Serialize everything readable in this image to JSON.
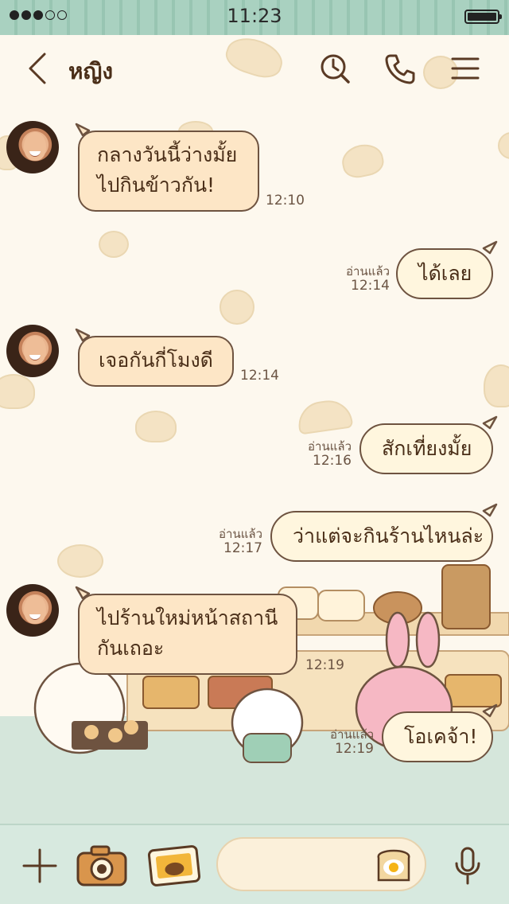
{
  "status_bar": {
    "time": "11:23",
    "signal_filled": 3,
    "signal_total": 5,
    "battery_level": 1.0
  },
  "header": {
    "title": "หญิง",
    "back_icon": "chevron-left-icon",
    "search_icon": "clock-search-icon",
    "call_icon": "phone-icon",
    "menu_icon": "hamburger-menu-icon"
  },
  "messages": [
    {
      "direction": "in",
      "lines": [
        "กลางวันนี้ว่างมั้ย",
        "ไปกินข้าวกัน!"
      ],
      "time": "12:10"
    },
    {
      "direction": "out",
      "text": "ได้เลย",
      "read": "อ่านแล้ว",
      "time": "12:14"
    },
    {
      "direction": "in",
      "lines": [
        "เจอกันกี่โมงดี"
      ],
      "time": "12:14"
    },
    {
      "direction": "out",
      "text": "สักเที่ยงมั้ย",
      "read": "อ่านแล้ว",
      "time": "12:16"
    },
    {
      "direction": "out",
      "text": "ว่าแต่จะกินร้านไหนล่ะ",
      "read": "อ่านแล้ว",
      "time": "12:17"
    },
    {
      "direction": "in",
      "lines": [
        "ไปร้านใหม่หน้าสถานี",
        "กันเถอะ"
      ],
      "time": "12:19"
    },
    {
      "direction": "out",
      "text": "โอเคจ้า!",
      "read": "อ่านแล้ว",
      "time": "12:19"
    }
  ],
  "bottom_bar": {
    "add_icon": "plus-icon",
    "camera_icon": "camera-icon",
    "gallery_icon": "photo-icon",
    "input_placeholder": "",
    "sticker_icon": "toast-egg-sticker-icon",
    "mic_icon": "microphone-icon"
  },
  "colors": {
    "header_text": "#4a2e18",
    "bubble_in": "#fde6c6",
    "bubble_out": "#fff6de",
    "bubble_border": "#6e5340",
    "bottom_bar": "#d7e9df",
    "status_bar": "#a9d1c0"
  }
}
